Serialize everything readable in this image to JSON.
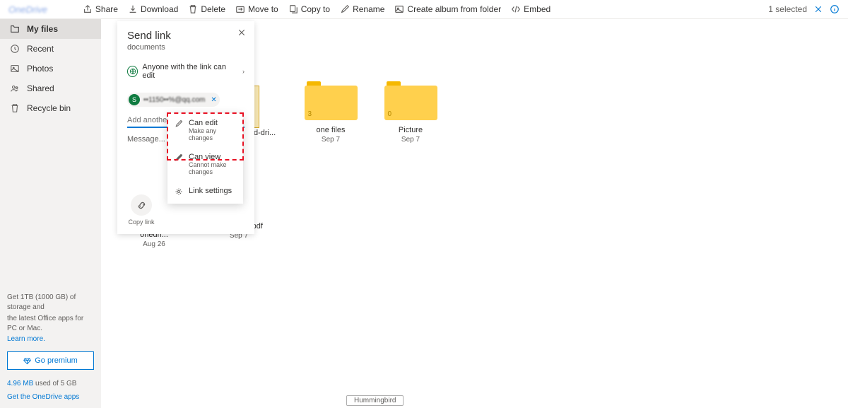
{
  "topbar": {
    "logo": "OneDrive",
    "actions": {
      "share": "Share",
      "download": "Download",
      "delete": "Delete",
      "moveto": "Move to",
      "copyto": "Copy to",
      "rename": "Rename",
      "createalbum": "Create album from folder",
      "embed": "Embed"
    },
    "selected": "1 selected"
  },
  "sidebar": {
    "items": [
      {
        "label": "My files"
      },
      {
        "label": "Recent"
      },
      {
        "label": "Photos"
      },
      {
        "label": "Shared"
      },
      {
        "label": "Recycle bin"
      }
    ],
    "promo_line1": "Get 1TB (1000 GB) of storage and",
    "promo_line2": "the latest Office apps for PC or Mac.",
    "learn_more": "Learn more.",
    "premium_btn": "Go premium",
    "storage_used": "4.96 MB",
    "storage_mid": " used of ",
    "storage_total": "5 GB",
    "get_apps": "Get the OneDrive apps"
  },
  "dialog": {
    "title": "Send link",
    "subtitle": "documents",
    "scope": "Anyone with the link can edit",
    "recipient_initial": "S",
    "recipient_email": "••1150••%@qq.com",
    "add_placeholder": "Add another",
    "message_placeholder": "Message...",
    "copy_link": "Copy link"
  },
  "permissions": {
    "can_edit": "Can edit",
    "can_edit_sub": "Make any changes",
    "can_view": "Can view",
    "can_view_sub": "Cannot make changes",
    "link_settings": "Link settings"
  },
  "files": {
    "folder2_name": "d-dri...",
    "folder3_name": "one files",
    "folder3_date": "Sep 7",
    "folder3_count": "3",
    "folder4_name": "Picture",
    "folder4_date": "Sep 7",
    "folder4_count": "0",
    "pdf1_name": "google-drive-vs-onedri...",
    "pdf1_date": "Aug 26",
    "pdf2_name": "OneDrive .pdf",
    "pdf2_date": "Sep 7"
  },
  "hummingbird": "Hummingbird"
}
